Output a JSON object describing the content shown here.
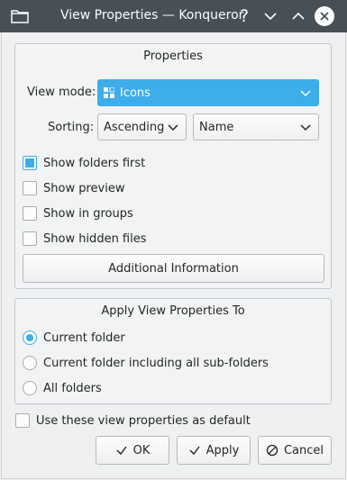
{
  "window": {
    "title": "View Properties — Konqueror",
    "help_glyph": "?"
  },
  "properties": {
    "group_title": "Properties",
    "view_mode_label": "View mode:",
    "view_mode_value": "Icons",
    "sorting_label": "Sorting:",
    "sort_order_value": "Ascending",
    "sort_by_value": "Name",
    "checkboxes": [
      {
        "label": "Show folders first",
        "checked": true
      },
      {
        "label": "Show preview",
        "checked": false
      },
      {
        "label": "Show in groups",
        "checked": false
      },
      {
        "label": "Show hidden files",
        "checked": false
      }
    ],
    "additional_info_label": "Additional Information"
  },
  "apply_to": {
    "group_title": "Apply View Properties To",
    "options": [
      {
        "label": "Current folder",
        "selected": true
      },
      {
        "label": "Current folder including all sub-folders",
        "selected": false
      },
      {
        "label": "All folders",
        "selected": false
      }
    ]
  },
  "default_checkbox": {
    "label": "Use these view properties as default",
    "checked": false
  },
  "buttons": {
    "ok": "OK",
    "apply": "Apply",
    "cancel": "Cancel"
  },
  "colors": {
    "accent": "#3daee9",
    "titlebar": "#475057"
  }
}
